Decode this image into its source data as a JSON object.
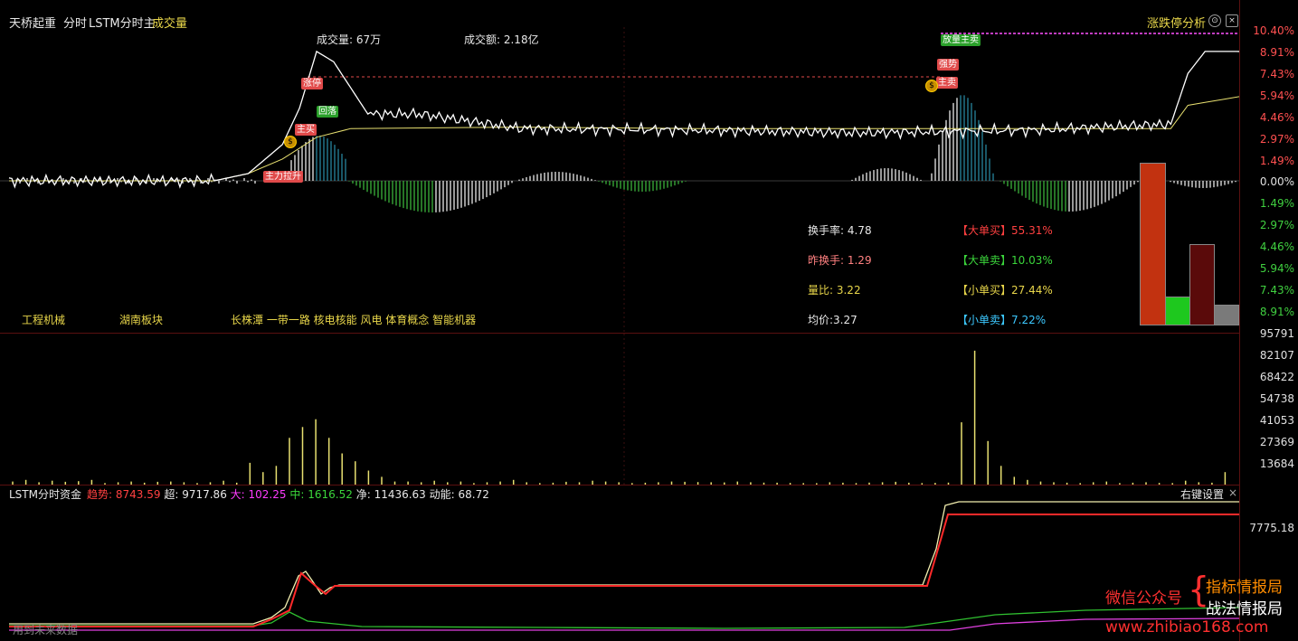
{
  "header": {
    "title": "天桥起重",
    "mode": "分时",
    "indicator": "LSTM分时主",
    "sub_indicator": "成交量",
    "right_menu": "涨跌停分析"
  },
  "summary": {
    "volume": "成交量: 67万",
    "amount": "成交额: 2.18亿"
  },
  "price_axis": {
    "up": [
      "10.40%",
      "8.91%",
      "7.43%",
      "5.94%",
      "4.46%",
      "2.97%",
      "1.49%"
    ],
    "zero": "0.00%",
    "down": [
      "1.49%",
      "2.97%",
      "4.46%",
      "5.94%",
      "7.43%",
      "8.91%"
    ]
  },
  "stats": {
    "turnover": "换手率: 4.78",
    "prev_turnover": "昨换手: 1.29",
    "vol_ratio": "量比: 3.22",
    "avg_price": "均价:3.27",
    "big_buy_label": "【大单买】",
    "big_buy_value": "55.31%",
    "big_sell_label": "【大单卖】",
    "big_sell_value": "10.03%",
    "small_buy_label": "【小单买】",
    "small_buy_value": "27.44%",
    "small_sell_label": "【小单卖】",
    "small_sell_value": "7.22%"
  },
  "sectors": {
    "industry": "工程机械",
    "region": "湖南板块",
    "concepts": "长株潭 一带一路 核电核能 风电 体育概念 智能机器"
  },
  "chart_tags": {
    "limit_sell": "涨停",
    "main_buy": "主买",
    "pullback": "回落",
    "main_break": "主力拉升",
    "vol_main_sell": "放量主卖",
    "strong": "强势",
    "main_sell2": "主卖",
    "coin": "$"
  },
  "volume_axis": [
    "95791",
    "82107",
    "68422",
    "54738",
    "41053",
    "27369",
    "13684"
  ],
  "lstm": {
    "title": "LSTM分时资金",
    "trend_label": "趋势:",
    "trend_value": "8743.59",
    "super_label": "超:",
    "super_value": "9717.86",
    "big_label": "大:",
    "big_value": "102.25",
    "mid_label": "中:",
    "mid_value": "1616.52",
    "net_label": "净:",
    "net_value": "11436.63",
    "momentum_label": "动能:",
    "momentum_value": "68.72",
    "right_settings": "右键设置",
    "close": "×",
    "axis_value": "7775.18",
    "bottom_note": "用到未来数据"
  },
  "watermark": {
    "wechat": "微信公众号",
    "brace": "{",
    "line1": "指标情报局",
    "line2": "战法情报局",
    "url": "www.zhibiao168.com"
  },
  "bar_colors": {
    "big_buy": "#c23210",
    "small_buy": "#1ec81e",
    "big_sell": "#5a0a0a",
    "small_sell": "#7a7a7a"
  },
  "chart_data": [
    {
      "type": "line",
      "title": "",
      "xlabel": "",
      "ylabel": "",
      "ylim": [
        -8.91,
        10.4
      ],
      "series": [
        {
          "x": [
            0,
            60,
            70,
            80,
            85,
            90,
            95,
            105,
            120,
            150,
            200,
            250,
            300,
            340,
            345,
            350,
            355,
            360
          ],
          "values": [
            0,
            0,
            0.5,
            2.5,
            5.0,
            8.91,
            8.2,
            4.6,
            4.6,
            3.6,
            3.5,
            3.3,
            3.5,
            3.9,
            7.4,
            8.91,
            8.91,
            8.91
          ]
        },
        {
          "x": [
            0,
            60,
            70,
            80,
            90,
            100,
            150,
            200,
            250,
            300,
            340,
            345,
            350,
            355,
            360
          ],
          "values": [
            0,
            0,
            0.5,
            1.5,
            3.0,
            3.6,
            3.7,
            3.6,
            3.6,
            3.6,
            3.6,
            5.2,
            5.4,
            5.6,
            5.8
          ]
        }
      ]
    },
    {
      "type": "bar",
      "title": "",
      "xlabel": "",
      "ylabel": "",
      "ylim": [
        0,
        95791
      ],
      "values": [
        2000,
        3000,
        1500,
        2500,
        1800,
        2200,
        3000,
        1000,
        1500,
        2000,
        1200,
        1800,
        2000,
        1500,
        1000,
        1500,
        2500,
        1200,
        14000,
        8000,
        12000,
        30000,
        37000,
        42000,
        30000,
        20000,
        15000,
        9000,
        5000,
        2000,
        2000,
        1500,
        2500,
        1500,
        2000,
        1000,
        1500,
        2000,
        3000,
        1500,
        1000,
        1200,
        1800,
        1500,
        2500,
        2000,
        1500,
        1000,
        1200,
        1500,
        2000,
        1800,
        1600,
        1500,
        1400,
        2000,
        1500,
        1300,
        1200,
        1100,
        1000,
        900,
        1500,
        1200,
        1000,
        1300,
        1500,
        1800,
        1200,
        1000,
        1100,
        1300,
        40000,
        86000,
        28000,
        12000,
        5000,
        3000,
        2000,
        1500,
        1200,
        1000,
        1500,
        2000,
        1000,
        1200,
        1500,
        1100,
        1000,
        2500,
        1500,
        1200,
        8000
      ]
    }
  ]
}
